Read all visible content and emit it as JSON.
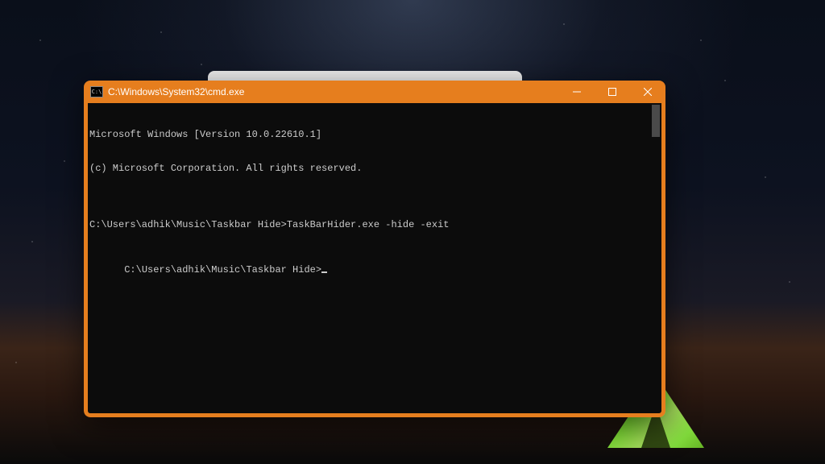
{
  "titlebar": {
    "title": "C:\\Windows\\System32\\cmd.exe"
  },
  "terminal": {
    "line1": "Microsoft Windows [Version 10.0.22610.1]",
    "line2": "(c) Microsoft Corporation. All rights reserved.",
    "line3": "",
    "line4": "C:\\Users\\adhik\\Music\\Taskbar Hide>TaskBarHider.exe -hide -exit",
    "line5": "",
    "prompt": "C:\\Users\\adhik\\Music\\Taskbar Hide>"
  }
}
